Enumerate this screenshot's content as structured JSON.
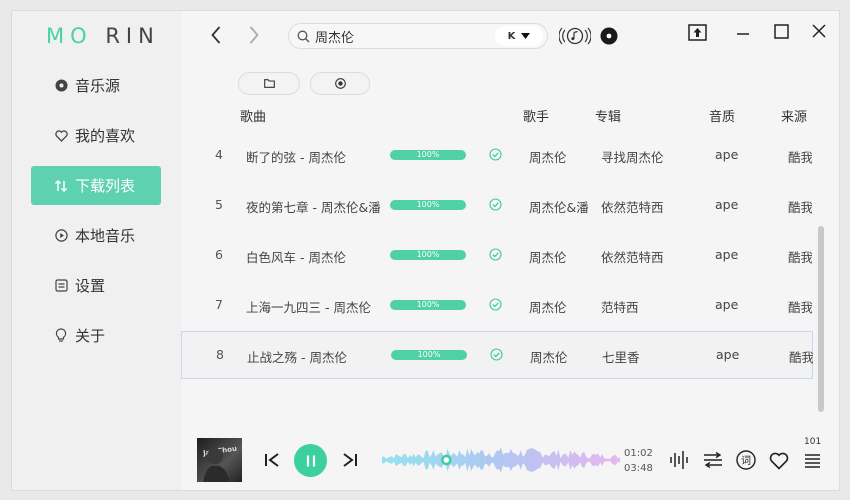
{
  "logo": {
    "part1": "MO",
    "part2": "RIN"
  },
  "nav": [
    {
      "label": "音乐源",
      "icon": "disc-icon"
    },
    {
      "label": "我的喜欢",
      "icon": "heart-icon"
    },
    {
      "label": "下载列表",
      "icon": "sort-icon"
    },
    {
      "label": "本地音乐",
      "icon": "play-circle-icon"
    },
    {
      "label": "设置",
      "icon": "settings-icon"
    },
    {
      "label": "关于",
      "icon": "lightbulb-icon"
    }
  ],
  "search": {
    "value": "周杰伦",
    "source_label": "K"
  },
  "columns": {
    "song": "歌曲",
    "singer": "歌手",
    "album": "专辑",
    "quality": "音质",
    "source": "来源"
  },
  "rows": [
    {
      "index": "4",
      "title": "断了的弦 - 周杰伦",
      "progress": "100%",
      "singer": "周杰伦",
      "album": "寻找周杰伦",
      "quality": "ape",
      "source": "酷我i"
    },
    {
      "index": "5",
      "title": "夜的第七章 - 周杰伦&潘",
      "progress": "100%",
      "singer": "周杰伦&潘",
      "album": "依然范特西",
      "quality": "ape",
      "source": "酷我i"
    },
    {
      "index": "6",
      "title": "白色风车 - 周杰伦",
      "progress": "100%",
      "singer": "周杰伦",
      "album": "依然范特西",
      "quality": "ape",
      "source": "酷我i"
    },
    {
      "index": "7",
      "title": "上海一九四三 - 周杰伦",
      "progress": "100%",
      "singer": "周杰伦",
      "album": "范特西",
      "quality": "ape",
      "source": "酷我i"
    },
    {
      "index": "8",
      "title": "止战之殇 - 周杰伦",
      "progress": "100%",
      "singer": "周杰伦",
      "album": "七里香",
      "quality": "ape",
      "source": "酷我i"
    }
  ],
  "player": {
    "current_time": "01:02",
    "total_time": "03:48",
    "progress_fraction": 0.27,
    "cover_text": "Jay Chou",
    "lyrics_label": "词",
    "volume": "101"
  },
  "colors": {
    "accent": "#4fd0a6",
    "active_nav": "#5ed1b0"
  }
}
